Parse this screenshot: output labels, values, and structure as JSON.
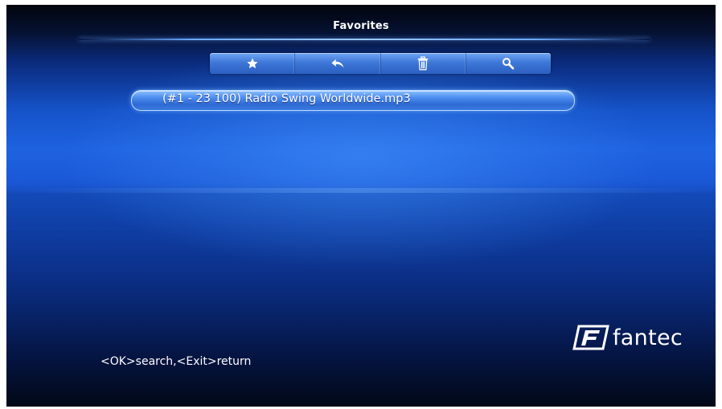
{
  "screen": {
    "title": "Favorites"
  },
  "toolbar": {
    "items": [
      {
        "icon": "star-icon",
        "label": "Favorites"
      },
      {
        "icon": "return-icon",
        "label": "Return"
      },
      {
        "icon": "trash-icon",
        "label": "Delete"
      },
      {
        "icon": "search-icon",
        "label": "Search"
      }
    ]
  },
  "list": {
    "items": [
      {
        "text": "(#1 - 23 100) Radio Swing Worldwide.mp3",
        "selected": true
      }
    ]
  },
  "footer": {
    "hint": "<OK>search,<Exit>return",
    "brand": "fantec"
  },
  "colors": {
    "background": "#1552c8",
    "accent": "#6aa8ff",
    "text": "#ffffff"
  }
}
